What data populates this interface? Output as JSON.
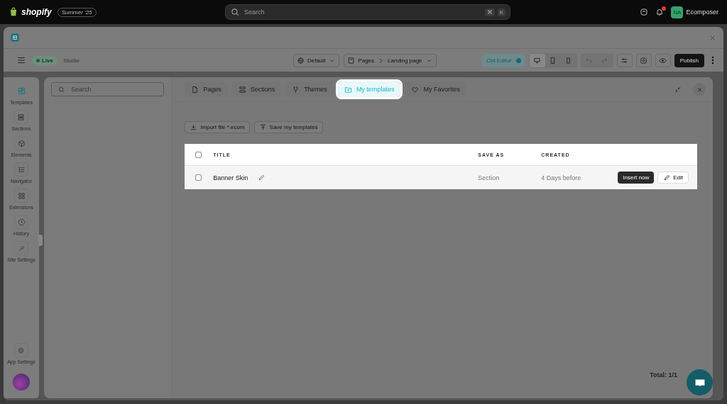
{
  "topbar": {
    "brand": "shopify",
    "edition": "Summer '25",
    "search": {
      "placeholder": "Search",
      "keys": [
        "⌘",
        "K"
      ]
    },
    "account": {
      "initials": "NA",
      "name": "Ecomposer"
    }
  },
  "toolbar": {
    "status": "Live",
    "mode": "Studio",
    "theme": "Default",
    "breadcrumb": [
      "Pages",
      "Landing page"
    ],
    "old_editor": {
      "label": "Old Editor",
      "on": true
    },
    "devices": [
      {
        "selected": true
      },
      {
        "selected": false
      },
      {
        "selected": false
      }
    ],
    "publish": "Publish"
  },
  "rail": {
    "items": [
      {
        "label": "Templates",
        "selected": true
      },
      {
        "label": "Sections",
        "selected": false
      },
      {
        "label": "Elements",
        "selected": false
      },
      {
        "label": "Navigator",
        "selected": false
      },
      {
        "label": "Extensions",
        "selected": false
      },
      {
        "label": "History",
        "selected": false
      },
      {
        "label": "Site Settings",
        "selected": false
      }
    ],
    "bottom": "App Settings"
  },
  "panel": {
    "search": {
      "placeholder": "Search"
    },
    "tabs": [
      {
        "label": "Pages",
        "selected": false
      },
      {
        "label": "Sections",
        "selected": false
      },
      {
        "label": "Themes",
        "selected": false
      },
      {
        "label": "My templates",
        "selected": true
      },
      {
        "label": "My Favorites",
        "selected": false
      }
    ],
    "actions": [
      "Import file *.ecom",
      "Save my templates"
    ],
    "table": {
      "columns": [
        "TITLE",
        "SAVE AS",
        "CREATED"
      ],
      "all_checked": false,
      "rows": [
        {
          "title": "Banner Skin",
          "save_as": "Section",
          "created": "4 Days before",
          "checked": false,
          "insert": "Insert now",
          "edit": "Edit"
        }
      ]
    },
    "total": "Total: 1/1"
  }
}
